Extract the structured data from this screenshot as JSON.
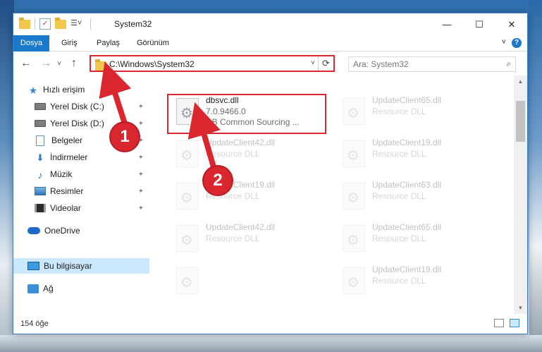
{
  "window": {
    "title": "System32",
    "minimize_label": "—",
    "maximize_label": "☐",
    "close_label": "✕"
  },
  "ribbon": {
    "tabs": [
      "Dosya",
      "Giriş",
      "Paylaş",
      "Görünüm"
    ],
    "expand_label": "˅",
    "help_label": "?"
  },
  "address_bar": {
    "path": "C:\\Windows\\System32",
    "refresh_icon": "⟳"
  },
  "search": {
    "placeholder": "Ara: System32"
  },
  "nav_buttons": {
    "back": "←",
    "forward": "→",
    "recent": "˅",
    "up": "↑"
  },
  "sidebar": {
    "items": [
      {
        "label": "Hızlı erişim",
        "icon": "star-icon",
        "pinned": false
      },
      {
        "label": "Yerel Disk (C:)",
        "icon": "drive-icon",
        "pinned": true
      },
      {
        "label": "Yerel Disk (D:)",
        "icon": "drive-icon",
        "pinned": true
      },
      {
        "label": "Belgeler",
        "icon": "document-icon",
        "pinned": true
      },
      {
        "label": "İndirmeler",
        "icon": "download-icon",
        "pinned": true
      },
      {
        "label": "Müzik",
        "icon": "music-icon",
        "pinned": true
      },
      {
        "label": "Resimler",
        "icon": "pictures-icon",
        "pinned": true
      },
      {
        "label": "Videolar",
        "icon": "video-icon",
        "pinned": true
      },
      {
        "label": "OneDrive",
        "icon": "cloud-icon",
        "pinned": false
      },
      {
        "label": "Bu bilgisayar",
        "icon": "computer-icon",
        "pinned": false,
        "selected": true
      },
      {
        "label": "Ağ",
        "icon": "network-icon",
        "pinned": false
      }
    ],
    "pin_glyph": "📌"
  },
  "files": {
    "highlighted": {
      "name": "dbsvc.dll",
      "version": "7.0.9466.0",
      "description": "DB Common Sourcing ..."
    },
    "left_column": [
      {
        "name": "UpdateClient42.dll",
        "type": "Resource DLL"
      },
      {
        "name": "UpdateClient19.dll",
        "type": "Resource DLL"
      },
      {
        "name": "UpdateClient42.dll",
        "type": "Resource DLL"
      }
    ],
    "right_column": [
      {
        "name": "UpdateClient65.dll",
        "type": "Resource DLL"
      },
      {
        "name": "UpdateClient19.dll",
        "type": "Resource DLL"
      },
      {
        "name": "UpdateClient63.dll",
        "type": "Resource DLL"
      },
      {
        "name": "UpdateClient65.dll",
        "type": "Resource DLL"
      },
      {
        "name": "UpdateClient19.dll",
        "type": "Resource DLL"
      }
    ]
  },
  "status_bar": {
    "item_count": "154 öğe"
  },
  "annotations": {
    "step1": "1",
    "step2": "2"
  },
  "colors": {
    "accent": "#1979ca",
    "highlight_red": "#d9262f",
    "selection": "#cce8ff"
  }
}
